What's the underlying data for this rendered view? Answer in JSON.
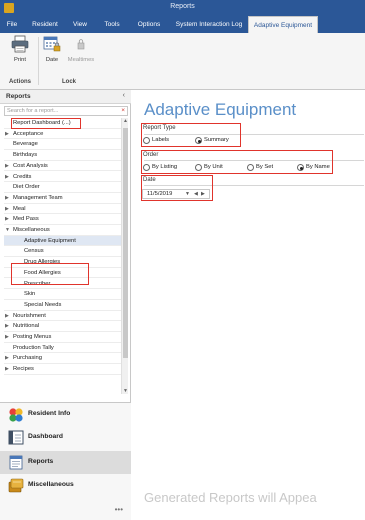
{
  "window": {
    "title": "Reports"
  },
  "ribbon_tabs": [
    "File",
    "Resident",
    "View",
    "Tools",
    "Options",
    "System Interaction Log",
    "Adaptive Equipment"
  ],
  "ribbon": {
    "print_label": "Print",
    "date_label": "Date",
    "mealtimes_label": "Mealtimes",
    "actions_group": "Actions",
    "lock_group": "Lock"
  },
  "reports_panel": {
    "title": "Reports",
    "collapse_glyph": "‹",
    "search_placeholder": "Search for a report...",
    "clear_glyph": "×",
    "items": [
      {
        "label": "Report Dashboard (...)",
        "expandable": false,
        "child": false
      },
      {
        "label": "Acceptance",
        "expandable": true,
        "child": false
      },
      {
        "label": "Beverage",
        "expandable": false,
        "child": false
      },
      {
        "label": "Birthdays",
        "expandable": false,
        "child": false
      },
      {
        "label": "Cost Analysis",
        "expandable": true,
        "child": false
      },
      {
        "label": "Credits",
        "expandable": true,
        "child": false
      },
      {
        "label": "Diet Order",
        "expandable": false,
        "child": false
      },
      {
        "label": "Management Team",
        "expandable": true,
        "child": false
      },
      {
        "label": "Meal",
        "expandable": true,
        "child": false
      },
      {
        "label": "Med Pass",
        "expandable": true,
        "child": false
      },
      {
        "label": "Miscellaneous",
        "expandable": true,
        "child": false,
        "expanded": true
      },
      {
        "label": "Adaptive Equipment",
        "expandable": false,
        "child": true,
        "selected": true
      },
      {
        "label": "Census",
        "expandable": false,
        "child": true
      },
      {
        "label": "Drug Allergies",
        "expandable": false,
        "child": true
      },
      {
        "label": "Food Allergies",
        "expandable": false,
        "child": true
      },
      {
        "label": "Prescriber",
        "expandable": false,
        "child": true
      },
      {
        "label": "Skin",
        "expandable": false,
        "child": true
      },
      {
        "label": "Special Needs",
        "expandable": false,
        "child": true
      },
      {
        "label": "Nourishment",
        "expandable": true,
        "child": false
      },
      {
        "label": "Nutritional",
        "expandable": true,
        "child": false
      },
      {
        "label": "Posting Menus",
        "expandable": true,
        "child": false
      },
      {
        "label": "Production Tally",
        "expandable": false,
        "child": false
      },
      {
        "label": "Purchasing",
        "expandable": true,
        "child": false
      },
      {
        "label": "Recipes",
        "expandable": true,
        "child": false
      }
    ]
  },
  "nav_pane": {
    "items": [
      {
        "label": "Resident Info",
        "icon": "resident-info-icon"
      },
      {
        "label": "Dashboard",
        "icon": "dashboard-icon"
      },
      {
        "label": "Reports",
        "icon": "reports-icon",
        "selected": true
      },
      {
        "label": "Miscellaneous",
        "icon": "miscellaneous-icon"
      }
    ],
    "more_glyph": "•••"
  },
  "main": {
    "title": "Adaptive Equipment",
    "report_type": {
      "label": "Report Type",
      "options": [
        "Labels",
        "Summary"
      ],
      "selected": "Summary"
    },
    "order": {
      "label": "Order",
      "options": [
        "By Listing",
        "By Unit",
        "By Set",
        "By Name"
      ],
      "selected": "By Name"
    },
    "date": {
      "label": "Date",
      "value": "11/5/2019"
    },
    "generated_text": "Generated Reports will Appea"
  },
  "colors": {
    "titlebar": "#2b5797",
    "accent_title": "#5a8fc8",
    "highlight_box": "#e0342c"
  }
}
